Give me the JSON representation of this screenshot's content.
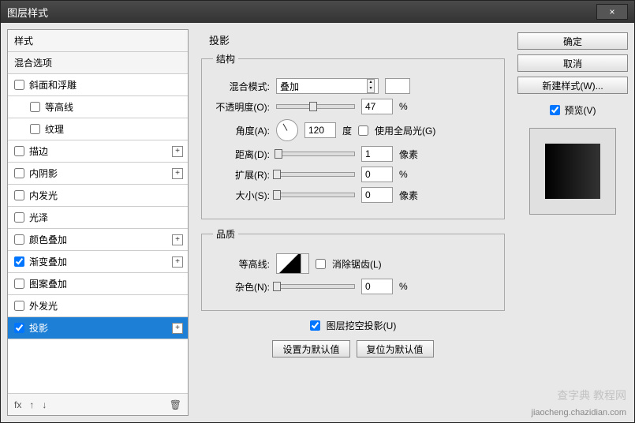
{
  "window": {
    "title": "图层样式",
    "close": "×"
  },
  "styles": {
    "header1": "样式",
    "header2": "混合选项",
    "items": [
      {
        "label": "斜面和浮雕",
        "checked": false,
        "plus": false
      },
      {
        "label": "等高线",
        "checked": false,
        "plus": false,
        "indent": true
      },
      {
        "label": "纹理",
        "checked": false,
        "plus": false,
        "indent": true
      },
      {
        "label": "描边",
        "checked": false,
        "plus": true
      },
      {
        "label": "内阴影",
        "checked": false,
        "plus": true
      },
      {
        "label": "内发光",
        "checked": false,
        "plus": false
      },
      {
        "label": "光泽",
        "checked": false,
        "plus": false
      },
      {
        "label": "颜色叠加",
        "checked": false,
        "plus": true
      },
      {
        "label": "渐变叠加",
        "checked": true,
        "plus": true
      },
      {
        "label": "图案叠加",
        "checked": false,
        "plus": false
      },
      {
        "label": "外发光",
        "checked": false,
        "plus": false
      },
      {
        "label": "投影",
        "checked": true,
        "plus": true,
        "selected": true
      }
    ],
    "footer_fx": "fx",
    "footer_up": "↑",
    "footer_down": "↓",
    "footer_trash": "🗑"
  },
  "section": {
    "title": "投影",
    "structure_legend": "结构",
    "quality_legend": "品质",
    "blend_mode_label": "混合模式:",
    "blend_mode_value": "叠加",
    "opacity_label": "不透明度(O):",
    "opacity_value": "47",
    "opacity_unit": "%",
    "angle_label": "角度(A):",
    "angle_value": "120",
    "angle_unit": "度",
    "global_light_label": "使用全局光(G)",
    "distance_label": "距离(D):",
    "distance_value": "1",
    "distance_unit": "像素",
    "spread_label": "扩展(R):",
    "spread_value": "0",
    "spread_unit": "%",
    "size_label": "大小(S):",
    "size_value": "0",
    "size_unit": "像素",
    "contour_label": "等高线:",
    "antialias_label": "消除锯齿(L)",
    "noise_label": "杂色(N):",
    "noise_value": "0",
    "noise_unit": "%",
    "knockout_label": "图层挖空投影(U)",
    "set_default": "设置为默认值",
    "reset_default": "复位为默认值"
  },
  "buttons": {
    "ok": "确定",
    "cancel": "取消",
    "new_style": "新建样式(W)...",
    "preview": "预览(V)"
  },
  "watermark": {
    "line1": "查字典 教程网",
    "line2": "jiaocheng.chazidian.com"
  }
}
